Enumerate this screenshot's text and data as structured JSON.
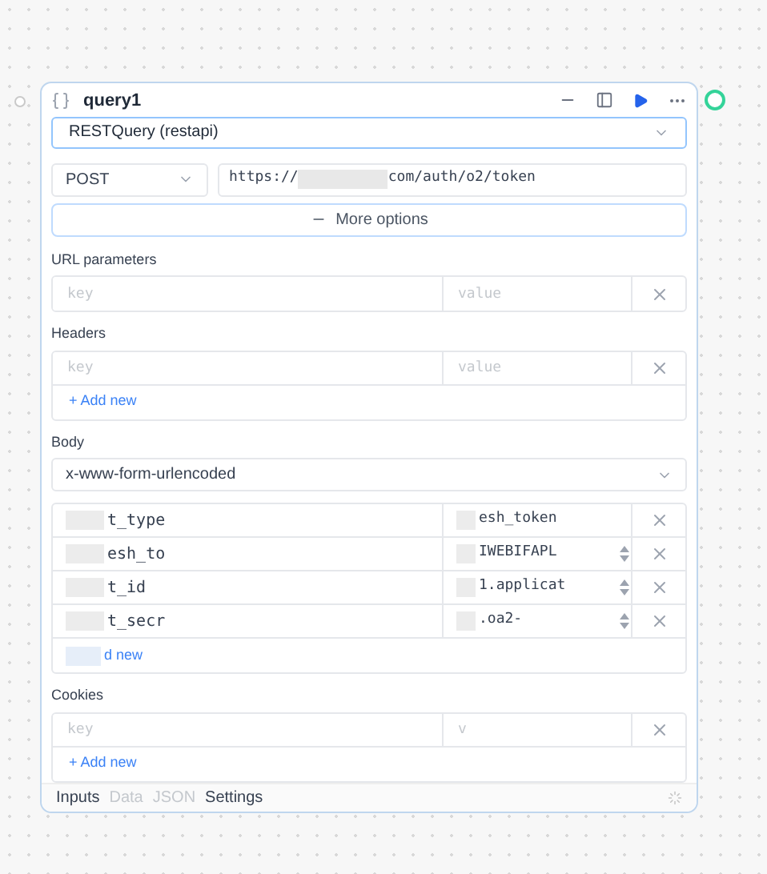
{
  "query": {
    "title": "query1",
    "resource": "RESTQuery (restapi)",
    "method": "POST",
    "url_prefix": "https://",
    "url_suffix": "com/auth/o2/token",
    "more_options": "More options"
  },
  "url_parameters": {
    "label": "URL parameters",
    "rows": [
      {
        "key_placeholder": "key",
        "value_placeholder": "value"
      }
    ]
  },
  "headers": {
    "label": "Headers",
    "rows": [
      {
        "key_placeholder": "key",
        "value_placeholder": "value"
      }
    ],
    "add_new": "+ Add new"
  },
  "body": {
    "label": "Body",
    "type": "x-www-form-urlencoded",
    "rows": [
      {
        "key": "t_type",
        "value": "esh_token",
        "spinner": false
      },
      {
        "key": "esh_to",
        "value": "IWEBIFAPL",
        "spinner": true
      },
      {
        "key": "t_id",
        "value": "1.applicat",
        "spinner": true
      },
      {
        "key": "t_secr",
        "value": ".oa2-",
        "spinner": true
      }
    ],
    "add_new": "d new"
  },
  "cookies": {
    "label": "Cookies",
    "rows": [
      {
        "key_placeholder": "key",
        "value_placeholder": "v"
      }
    ],
    "add_new": "+ Add new"
  },
  "footer_tabs": [
    {
      "label": "Inputs",
      "disabled": false
    },
    {
      "label": "Data",
      "disabled": true
    },
    {
      "label": "JSON",
      "disabled": true
    },
    {
      "label": "Settings",
      "disabled": false
    }
  ]
}
